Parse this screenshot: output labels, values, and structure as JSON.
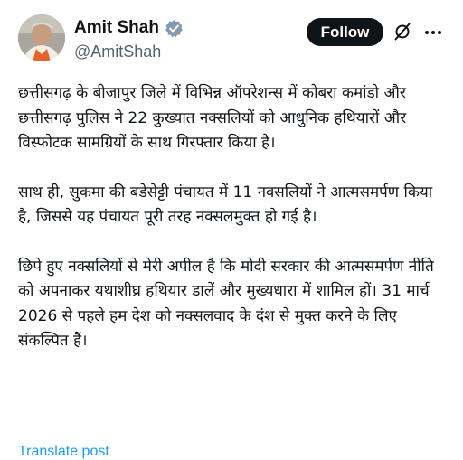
{
  "author": {
    "display_name": "Amit Shah",
    "handle": "@AmitShah",
    "verified": true
  },
  "actions": {
    "follow_label": "Follow",
    "icons": [
      "grok-icon",
      "more-icon"
    ]
  },
  "tweet": {
    "paragraphs": [
      "छत्तीसगढ़ के बीजापुर जिले में विभिन्न ऑपरेशन्स में कोबरा कमांडो और छत्तीसगढ़ पुलिस ने 22 कुख्यात नक्सलियों को आधुनिक हथियारों और विस्फोटक सामग्रियों के साथ गिरफ्तार किया है।",
      "साथ ही, सुकमा की बडेसेट्टी पंचायत में 11 नक्सलियों ने आत्मसमर्पण किया है, जिससे यह पंचायत पूरी तरह नक्सलमुक्त हो गई है।",
      "छिपे हुए नक्सलियों से मेरी अपील है कि मोदी सरकार की आत्मसमर्पण नीति को अपनाकर यथाशीघ्र हथियार डालें और मुख्यधारा में शामिल हों। 31 मार्च 2026 से पहले हम देश को नक्सलवाद के दंश से मुक्त करने के लिए संकल्पित हैं।"
    ],
    "translate_label": "Translate post"
  },
  "colors": {
    "text": "#0f1419",
    "secondary": "#536471",
    "link": "#1d9bf0",
    "follow_bg": "#0f1419"
  }
}
